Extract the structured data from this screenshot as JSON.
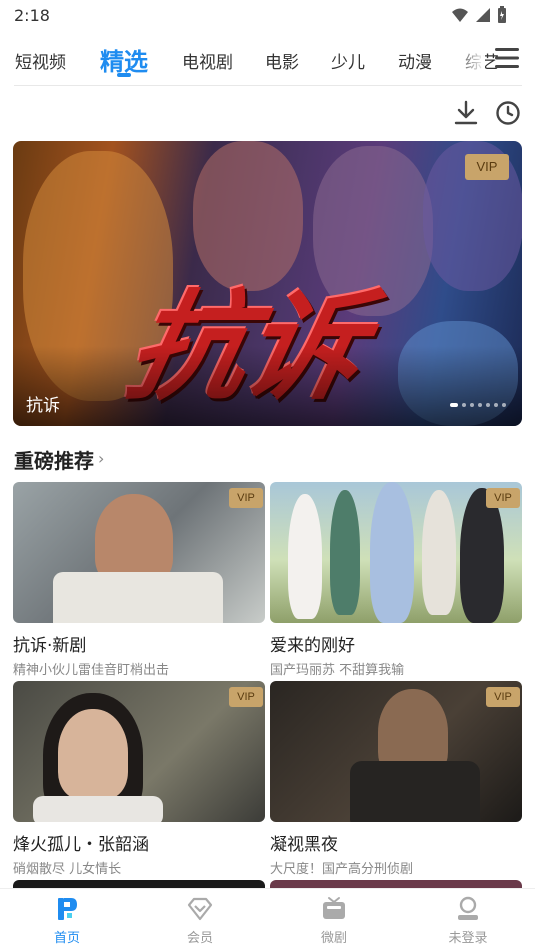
{
  "status_bar": {
    "time": "2:18"
  },
  "channel_tabs": [
    {
      "label": "短视频"
    },
    {
      "label": "精选"
    },
    {
      "label": "电视剧"
    },
    {
      "label": "电影"
    },
    {
      "label": "少儿"
    },
    {
      "label": "动漫"
    },
    {
      "label": "综艺"
    }
  ],
  "active_tab": "精选",
  "icons": {
    "menu": "menu-icon",
    "download": "download-icon",
    "history": "history-icon",
    "home": "home-icon",
    "member": "diamond-icon",
    "shorts": "tv-icon",
    "profile": "user-icon"
  },
  "banner": {
    "title": "抗诉",
    "logo_text": "抗诉",
    "badge": "VIP",
    "slide_count": 7,
    "active_slide": 1
  },
  "section": {
    "title": "重磅推荐",
    "chevron": "›"
  },
  "cards": [
    {
      "title": "抗诉·新剧",
      "subtitle": "精神小伙儿雷佳音盯梢出击",
      "badge": "VIP"
    },
    {
      "title": "爱来的刚好",
      "subtitle": "国产玛丽苏 不甜算我输",
      "badge": "VIP"
    },
    {
      "title": "烽火孤儿・张韶涵",
      "subtitle": "硝烟散尽 儿女情长",
      "badge": "VIP"
    },
    {
      "title": "凝视黑夜",
      "subtitle": "大尺度！国产高分刑侦剧",
      "badge": "VIP"
    }
  ],
  "bottom_nav": [
    {
      "label": "首页"
    },
    {
      "label": "会员"
    },
    {
      "label": "微剧"
    },
    {
      "label": "未登录"
    }
  ],
  "colors": {
    "accent": "#1f8cf0",
    "vip_badge": "#c8a46a",
    "text": "#222222",
    "muted": "#888888"
  }
}
